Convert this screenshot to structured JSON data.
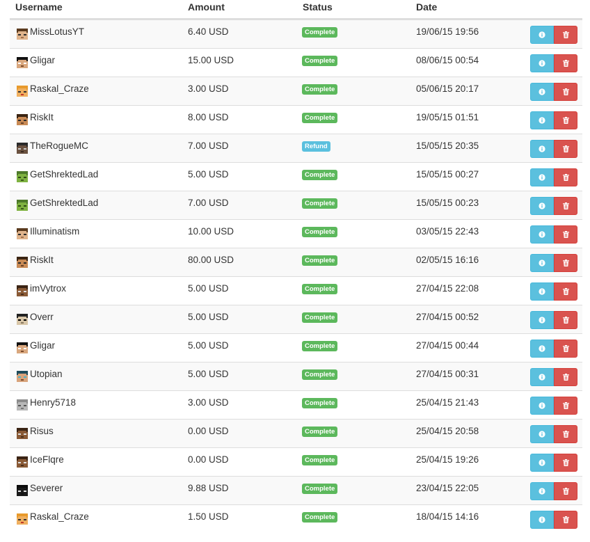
{
  "table": {
    "headers": {
      "username": "Username",
      "amount": "Amount",
      "status": "Status",
      "date": "Date"
    },
    "rows": [
      {
        "username": "MissLotusYT",
        "amount": "6.40 USD",
        "status": "Complete",
        "date": "19/06/15 19:56",
        "avatar": "skin-tan"
      },
      {
        "username": "Gligar",
        "amount": "15.00 USD",
        "status": "Complete",
        "date": "08/06/15 00:54",
        "avatar": "skin-black-hair"
      },
      {
        "username": "Raskal_Craze",
        "amount": "3.00 USD",
        "status": "Complete",
        "date": "05/06/15 20:17",
        "avatar": "skin-orange"
      },
      {
        "username": "RiskIt",
        "amount": "8.00 USD",
        "status": "Complete",
        "date": "19/05/15 01:51",
        "avatar": "skin-brown"
      },
      {
        "username": "TheRogueMC",
        "amount": "7.00 USD",
        "status": "Refund",
        "date": "15/05/15 20:35",
        "avatar": "skin-dark"
      },
      {
        "username": "GetShrektedLad",
        "amount": "5.00 USD",
        "status": "Complete",
        "date": "15/05/15 00:27",
        "avatar": "skin-green"
      },
      {
        "username": "GetShrektedLad",
        "amount": "7.00 USD",
        "status": "Complete",
        "date": "15/05/15 00:23",
        "avatar": "skin-green"
      },
      {
        "username": "Illuminatism",
        "amount": "10.00 USD",
        "status": "Complete",
        "date": "03/05/15 22:43",
        "avatar": "skin-tan"
      },
      {
        "username": "RiskIt",
        "amount": "80.00 USD",
        "status": "Complete",
        "date": "02/05/15 16:16",
        "avatar": "skin-brown"
      },
      {
        "username": "imVytrox",
        "amount": "5.00 USD",
        "status": "Complete",
        "date": "27/04/15 22:08",
        "avatar": "skin-brown-dark"
      },
      {
        "username": "Overr",
        "amount": "5.00 USD",
        "status": "Complete",
        "date": "27/04/15 00:52",
        "avatar": "skin-gray-shades"
      },
      {
        "username": "Gligar",
        "amount": "5.00 USD",
        "status": "Complete",
        "date": "27/04/15 00:44",
        "avatar": "skin-black-hair"
      },
      {
        "username": "Utopian",
        "amount": "5.00 USD",
        "status": "Complete",
        "date": "27/04/15 00:31",
        "avatar": "skin-teal"
      },
      {
        "username": "Henry5718",
        "amount": "3.00 USD",
        "status": "Complete",
        "date": "25/04/15 21:43",
        "avatar": "skin-gray"
      },
      {
        "username": "Risus",
        "amount": "0.00 USD",
        "status": "Complete",
        "date": "25/04/15 20:58",
        "avatar": "skin-brown-dark"
      },
      {
        "username": "IceFlqre",
        "amount": "0.00 USD",
        "status": "Complete",
        "date": "25/04/15 19:26",
        "avatar": "skin-brown-dark"
      },
      {
        "username": "Severer",
        "amount": "9.88 USD",
        "status": "Complete",
        "date": "23/04/15 22:05",
        "avatar": "skin-black-mask"
      },
      {
        "username": "Raskal_Craze",
        "amount": "1.50 USD",
        "status": "Complete",
        "date": "18/04/15 14:16",
        "avatar": "skin-orange"
      }
    ]
  },
  "actions": {
    "info_icon": "info-icon",
    "delete_icon": "trash-icon"
  },
  "colors": {
    "complete": "#5cb85c",
    "refund": "#5bc0de",
    "info_button": "#5bc0de",
    "delete_button": "#d9534f",
    "border": "#dddddd",
    "stripe": "#f9f9f9"
  }
}
